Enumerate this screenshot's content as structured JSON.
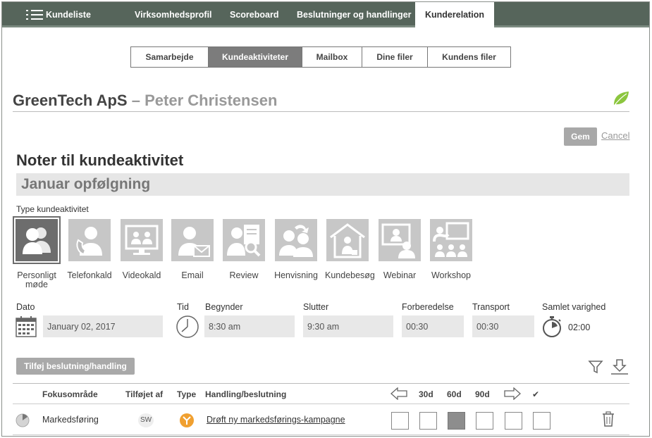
{
  "nav": {
    "menu_label": "Kundeliste",
    "items": [
      "Virksomhedsprofil",
      "Scoreboard",
      "Beslutninger og handlinger",
      "Kunderelation"
    ],
    "active": "Kunderelation"
  },
  "subtabs": {
    "items": [
      "Samarbejde",
      "Kundeaktiviteter",
      "Mailbox",
      "Dine filer",
      "Kundens filer"
    ],
    "active": "Kundeaktiviteter"
  },
  "header": {
    "company": "GreenTech ApS",
    "separator": "–",
    "person": "Peter Christensen",
    "leaf_color": "#8cc63f"
  },
  "actions": {
    "save": "Gem",
    "cancel": "Cancel"
  },
  "notes": {
    "title": "Noter til kundeaktivitet",
    "subject": "Januar opfølgning"
  },
  "activity": {
    "label": "Type kundeaktivitet",
    "types": [
      {
        "label": "Personligt møde",
        "icon": "meeting-icon",
        "selected": true
      },
      {
        "label": "Telefonkald",
        "icon": "phone-icon",
        "selected": false
      },
      {
        "label": "Videokald",
        "icon": "video-call-icon",
        "selected": false
      },
      {
        "label": "Email",
        "icon": "email-icon",
        "selected": false
      },
      {
        "label": "Review",
        "icon": "review-icon",
        "selected": false
      },
      {
        "label": "Henvisning",
        "icon": "referral-icon",
        "selected": false
      },
      {
        "label": "Kundebesøg",
        "icon": "customer-visit-icon",
        "selected": false
      },
      {
        "label": "Webinar",
        "icon": "webinar-icon",
        "selected": false
      },
      {
        "label": "Workshop",
        "icon": "workshop-icon",
        "selected": false
      }
    ]
  },
  "schedule": {
    "date_label": "Dato",
    "date": "January 02, 2017",
    "time_label": "Tid",
    "start_label": "Begynder",
    "start": "8:30 am",
    "end_label": "Slutter",
    "end": "9:30 am",
    "prep_label": "Forberedelse",
    "prep": "00:30",
    "transport_label": "Transport",
    "transport": "00:30",
    "total_label": "Samlet varighed",
    "total": "02:00"
  },
  "decisions": {
    "add_button": "Tilføj beslutning/handling",
    "columns": {
      "focus": "Fokusområde",
      "added_by": "Tilføjet af",
      "type": "Type",
      "action": "Handling/beslutning",
      "d30": "30d",
      "d60": "60d",
      "d90": "90d",
      "done": "✔"
    },
    "rows": [
      {
        "focus": "Markedsføring",
        "added_by": "SW",
        "type_color": "#f0a030",
        "action": "Drøft ny markedsførings-kampagne",
        "checks": [
          false,
          false,
          true,
          false,
          false,
          false
        ]
      }
    ]
  }
}
